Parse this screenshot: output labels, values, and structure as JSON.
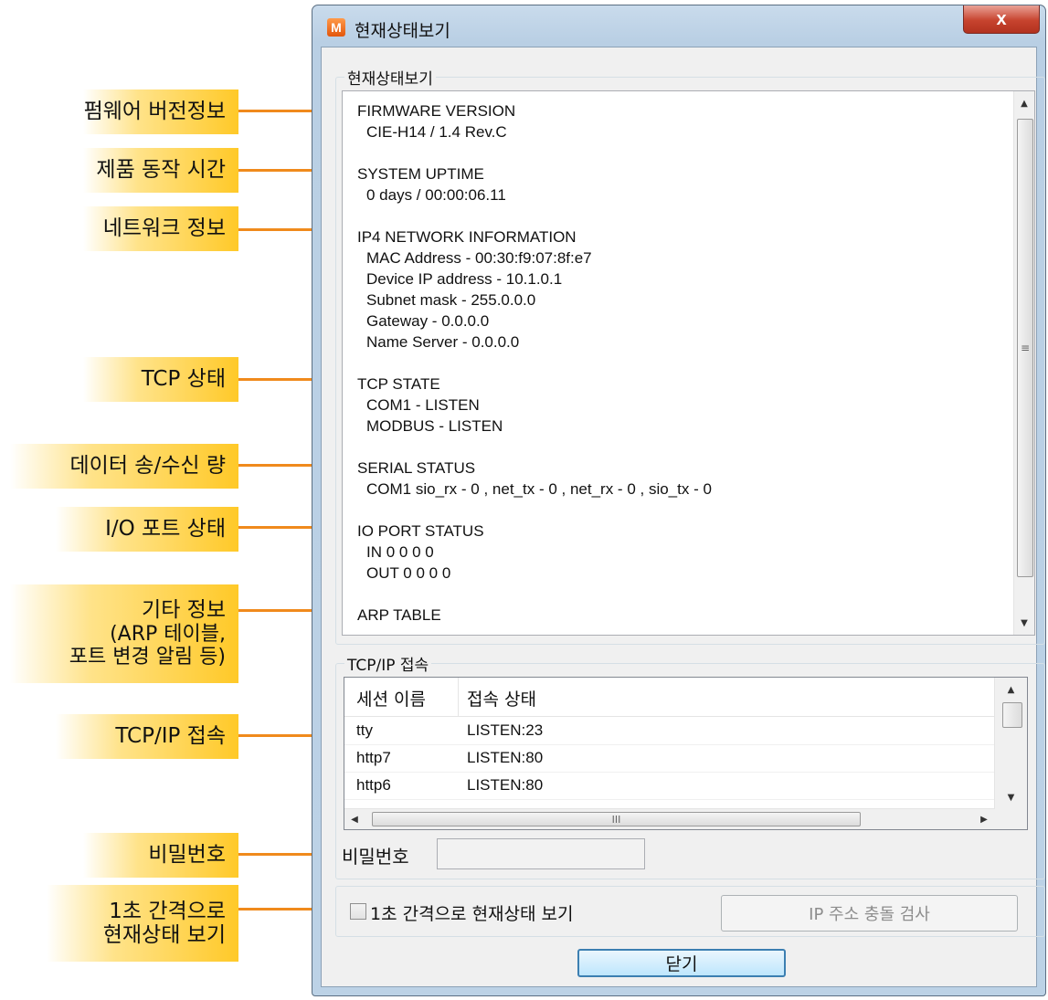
{
  "callouts": [
    {
      "id": "firmware",
      "text": "펌웨어 버전정보"
    },
    {
      "id": "uptime",
      "text": "제품 동작 시간"
    },
    {
      "id": "network",
      "text": "네트워크 정보"
    },
    {
      "id": "tcp",
      "text": "TCP 상태"
    },
    {
      "id": "serial",
      "text": "데이터 송/수신 량"
    },
    {
      "id": "io",
      "text": "I/O 포트 상태"
    },
    {
      "id": "etc",
      "lines": [
        "기타 정보",
        "(ARP 테이블,",
        "포트 변경 알림 등)"
      ]
    },
    {
      "id": "tcpip",
      "text": "TCP/IP 접속"
    },
    {
      "id": "password",
      "text": "비밀번호"
    },
    {
      "id": "interval",
      "lines": [
        "1초 간격으로",
        "현재상태 보기"
      ]
    }
  ],
  "window": {
    "icon_letter": "M",
    "title": "현재상태보기",
    "close_symbol": "x"
  },
  "status": {
    "group_label": "현재상태보기",
    "lines": {
      "firmware_h": "FIRMWARE VERSION",
      "firmware_v": "CIE-H14 / 1.4 Rev.C",
      "uptime_h": "SYSTEM UPTIME",
      "uptime_v": "0 days / 00:00:06.11",
      "net_h": "IP4 NETWORK INFORMATION",
      "net_mac": "MAC Address - 00:30:f9:07:8f:e7",
      "net_ip": "Device IP address - 10.1.0.1",
      "net_mask": "Subnet mask - 255.0.0.0",
      "net_gw": "Gateway - 0.0.0.0",
      "net_dns": "Name Server - 0.0.0.0",
      "tcp_h": "TCP STATE",
      "tcp_com1": "COM1 - LISTEN",
      "tcp_modbus": "MODBUS - LISTEN",
      "serial_h": "SERIAL STATUS",
      "serial_com1": "COM1  sio_rx - 0 , net_tx - 0 , net_rx - 0 , sio_tx - 0",
      "io_h": "IO PORT STATUS",
      "io_in": "IN  0 0 0 0",
      "io_out": "OUT  0 0 0 0",
      "arp_h": "ARP TABLE"
    }
  },
  "tcpip": {
    "group_label": "TCP/IP 접속",
    "columns": [
      "세션 이름",
      "접속 상태"
    ],
    "rows": [
      {
        "name": "tty",
        "state": "LISTEN:23"
      },
      {
        "name": "http7",
        "state": "LISTEN:80"
      },
      {
        "name": "http6",
        "state": "LISTEN:80"
      }
    ]
  },
  "password": {
    "label": "비밀번호",
    "value": ""
  },
  "options": {
    "interval_label": "1초 간격으로 현재상태 보기",
    "ip_check_label": "IP 주소 충돌 검사",
    "close_label": "닫기"
  },
  "colors": {
    "callout": "#ffc928",
    "connector": "#f08a1c",
    "window_frame": "#bcd2e6"
  }
}
